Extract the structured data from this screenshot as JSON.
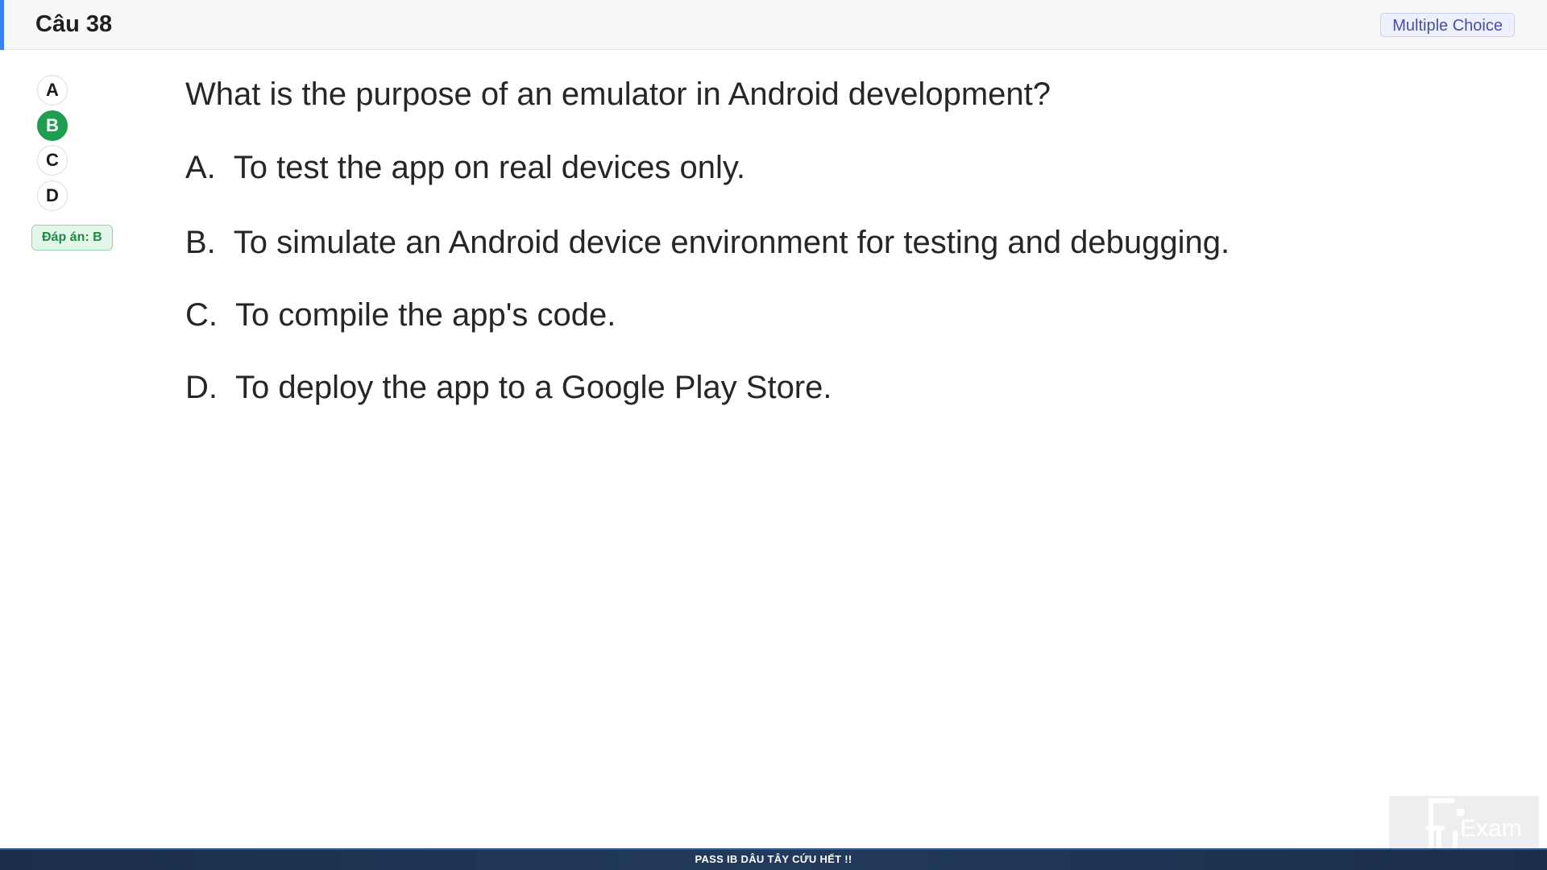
{
  "header": {
    "title": "Câu 38",
    "type_badge": "Multiple Choice"
  },
  "selector": {
    "options": [
      "A",
      "B",
      "C",
      "D"
    ],
    "selected": "B",
    "answer_label": "Đáp án: B"
  },
  "question": {
    "text": "What is the purpose of an emulator in Android development?",
    "choices": [
      {
        "letter": "A.",
        "text": "To test the app on real devices only."
      },
      {
        "letter": "B.",
        "text": "To simulate an Android device environment for testing and debugging."
      },
      {
        "letter": "C.",
        "text": "To compile the app's code."
      },
      {
        "letter": "D.",
        "text": "To deploy the app to a Google Play Store."
      }
    ]
  },
  "footer": {
    "text": "PASS IB DÂU TÂY CỨU HẾT !!"
  },
  "logo": {
    "text": "Exam",
    "icon": "fu-exam-logo-icon"
  },
  "colors": {
    "accent_blue": "#3b82f6",
    "selected_green": "#1e9e4f",
    "badge_purple": "#4650a8",
    "footer_navy": "#1b2e4b"
  }
}
